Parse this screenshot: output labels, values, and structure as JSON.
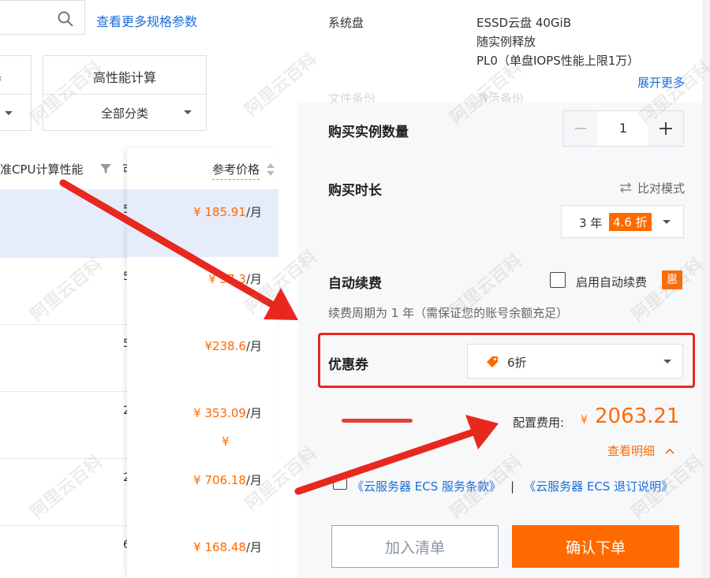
{
  "left": {
    "more_specs_link": "查看更多规格参数",
    "filter_col1_title": "器",
    "filter_col2_title": "高性能计算",
    "filter_col2_select": "全部分类",
    "table": {
      "header_cpu": "准CPU计算性能",
      "header_cut": "可",
      "header_price": "参考价格",
      "currency": "¥",
      "per_unit": "/月",
      "rows": [
        {
          "cut": "5",
          "price": "185.91"
        },
        {
          "cut": "5",
          "price": "37  3"
        },
        {
          "cut": "5",
          "price": "238.6"
        },
        {
          "cut": "2",
          "price": "353.09"
        },
        {
          "cut": "2",
          "price": "706.18"
        },
        {
          "cut": "6",
          "price": "168.48"
        }
      ],
      "row4_extra": "¥"
    }
  },
  "right": {
    "system_disk_label": "系统盘",
    "system_disk_values": [
      "ESSD云盘 40GiB",
      "随实例释放",
      "PL0（单盘IOPS性能上限1万）"
    ],
    "expand_more": "展开更多",
    "file_backup_label": "文件备份",
    "file_backup_value": "激活备份",
    "quantity_label": "购买实例数量",
    "quantity_value": "1",
    "duration_label": "购买时长",
    "compare_mode": "比对模式",
    "duration_value": "3 年",
    "duration_discount": "4.6 折",
    "auto_renew_label": "自动续费",
    "auto_renew_option": "启用自动续费",
    "auto_renew_badge": "惠",
    "renew_note": "续费周期为 1 年（需保证您的账号余额充足）",
    "coupon_label": "优惠券",
    "coupon_value": "6折",
    "cost_label": "配置费用:",
    "cost_currency": "¥",
    "cost_value": "2063.21",
    "detail_link": "查看明细",
    "agreement_link1": "《云服务器 ECS 服务条款》",
    "agreement_sep": "|",
    "agreement_link2": "《云服务器 ECS 退订说明》",
    "add_to_list": "加入清单",
    "confirm_order": "确认下单"
  },
  "watermark": "阿里云百科",
  "colors": {
    "accent": "#ff6a00",
    "link": "#1a6fd9",
    "annotation": "#e8281f"
  }
}
